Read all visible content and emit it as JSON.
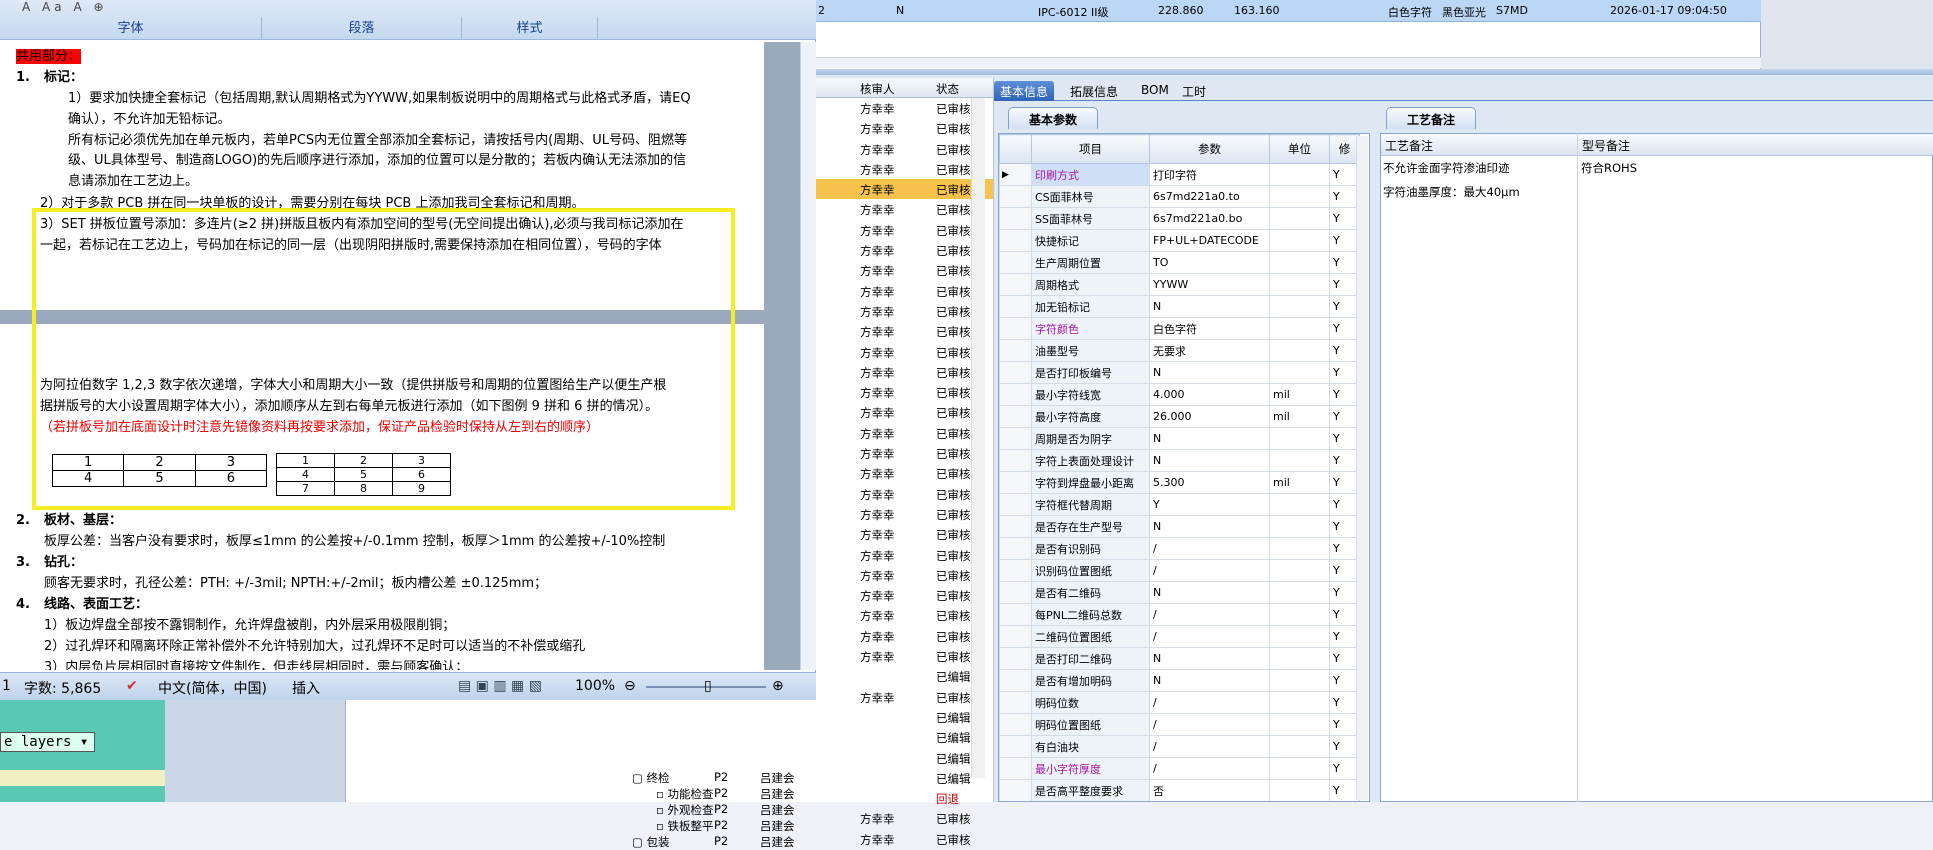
{
  "top_row": {
    "col1": "2",
    "col2": "N",
    "col3": "IPC-6012 II级",
    "col4": "228.860",
    "col5": "163.160",
    "col6": "白色字符",
    "col7": "黑色亚光",
    "col8": "S7MD",
    "col9": "2026-01-17 09:04:50"
  },
  "ribbon": {
    "font": "字体",
    "paragraph": "段落",
    "style": "样式"
  },
  "doc": {
    "heading": "共用部分：",
    "s1": "1.",
    "s1_title": "标记：",
    "l1": "1）要求加快捷全套标记（包括周期,默认周期格式为YYWW,如果制板说明中的周期格式与此格式矛盾，请EQ",
    "l2": "确认），不允许加无铅标记。",
    "l3": "所有标记必须优先加在单元板内，若单PCS内无位置全部添加全套标记，请按括号内(周期、UL号码、阻燃等",
    "l4": "级、UL具体型号、制造商LOGO)的先后顺序进行添加，添加的位置可以是分散的；若板内确认无法添加的信",
    "l5": "息请添加在工艺边上。",
    "l6": "2）对于多款 PCB 拼在同一块单板的设计，需要分别在每块 PCB 上添加我司全套标记和周期。",
    "l7": "3）SET 拼板位置号添加：多连片(≥2 拼)拼版且板内有添加空间的型号(无空间提出确认),必须与我司标记添加在",
    "l8": "一起，若标记在工艺边上，号码加在标记的同一层（出现阴阳拼版时,需要保持添加在相同位置），号码的字体",
    "l9": "为阿拉伯数字 1,2,3 数字依次递增，字体大小和周期大小一致（提供拼版号和周期的位置图给生产以便生产根",
    "l10": "据拼版号的大小设置周期字体大小），添加顺序从左到右每单元板进行添加（如下图例 9 拼和 6 拼的情况）。",
    "l11": "（若拼板号加在底面设计时注意先镜像资料再按要求添加，保证产品检验时保持从左到右的顺序）",
    "t6": [
      "1",
      "2",
      "3",
      "4",
      "5",
      "6"
    ],
    "t9": [
      "1",
      "2",
      "3",
      "4",
      "5",
      "6",
      "7",
      "8",
      "9"
    ],
    "s2": "2.",
    "s2_title": "板材、基层：",
    "l12": "板厚公差：当客户没有要求时，板厚≤1mm 的公差按+/-0.1mm 控制，板厚＞1mm 的公差按+/-10%控制",
    "s3": "3.",
    "s3_title": "钻孔：",
    "l13": "顾客无要求时，孔径公差：PTH: +/-3mil; NPTH:+/-2mil；板内槽公差 ±0.125mm；",
    "s4": "4.",
    "s4_title": "线路、表面工艺：",
    "l14": "1）板边焊盘全部按不露铜制作，允许焊盘被削，内外层采用极限削铜；",
    "l15": "2）过孔焊环和隔离环除正常补偿外不允许特别加大，过孔焊环不足时可以适当的不补偿或缩孔",
    "l16": "3）内层负片层相同时直接按文件制作，但走线层相同时，需与顾客确认；"
  },
  "status": {
    "words": "字数: 5,865",
    "lang": "中文(简体，中国)",
    "mode": "插入",
    "zoom": "100%",
    "page": "1"
  },
  "tree": {
    "headers": [
      "核审人",
      "状态"
    ],
    "reviewer": "方幸幸",
    "status_ok": "已审核",
    "status_edit": "已编辑",
    "status_back": "回退",
    "rows": [
      {
        "r": "方幸幸",
        "s": "已审核"
      },
      {
        "r": "方幸幸",
        "s": "已审核"
      },
      {
        "r": "方幸幸",
        "s": "已审核"
      },
      {
        "r": "方幸幸",
        "s": "已审核"
      },
      {
        "r": "方幸幸",
        "s": "已审核",
        "sel": true
      },
      {
        "r": "方幸幸",
        "s": "已审核"
      },
      {
        "r": "方幸幸",
        "s": "已审核"
      },
      {
        "r": "方幸幸",
        "s": "已审核"
      },
      {
        "r": "方幸幸",
        "s": "已审核"
      },
      {
        "r": "方幸幸",
        "s": "已审核"
      },
      {
        "r": "方幸幸",
        "s": "已审核"
      },
      {
        "r": "方幸幸",
        "s": "已审核"
      },
      {
        "r": "方幸幸",
        "s": "已审核"
      },
      {
        "r": "方幸幸",
        "s": "已审核"
      },
      {
        "r": "方幸幸",
        "s": "已审核"
      },
      {
        "r": "方幸幸",
        "s": "已审核"
      },
      {
        "r": "方幸幸",
        "s": "已审核"
      },
      {
        "r": "方幸幸",
        "s": "已审核"
      },
      {
        "r": "方幸幸",
        "s": "已审核"
      },
      {
        "r": "方幸幸",
        "s": "已审核"
      },
      {
        "r": "方幸幸",
        "s": "已审核"
      },
      {
        "r": "方幸幸",
        "s": "已审核"
      },
      {
        "r": "方幸幸",
        "s": "已审核"
      },
      {
        "r": "方幸幸",
        "s": "已审核"
      },
      {
        "r": "方幸幸",
        "s": "已审核"
      },
      {
        "r": "方幸幸",
        "s": "已审核"
      },
      {
        "r": "方幸幸",
        "s": "已审核"
      },
      {
        "r": "方幸幸",
        "s": "已审核"
      },
      {
        "r": "",
        "s": "已编辑"
      },
      {
        "r": "方幸幸",
        "s": "已审核"
      },
      {
        "r": "",
        "s": "已编辑"
      },
      {
        "r": "",
        "s": "已编辑"
      },
      {
        "r": "",
        "s": "已编辑"
      },
      {
        "r": "",
        "s": "已编辑"
      },
      {
        "r": "",
        "s": "回退"
      },
      {
        "r": "方幸幸",
        "s": "已审核"
      },
      {
        "r": "方幸幸",
        "s": "已审核"
      }
    ]
  },
  "tabs": [
    "基本信息",
    "拓展信息",
    "BOM",
    "工时"
  ],
  "subtab_left": "基本参数",
  "subtab_right": "工艺备注",
  "grid": {
    "headers": [
      "项目",
      "参数",
      "单位",
      "修"
    ],
    "rows": [
      {
        "n": "印刷方式",
        "v": "打印字符",
        "u": "",
        "y": "Y",
        "p": true,
        "cur": true
      },
      {
        "n": "CS面菲林号",
        "v": "6s7md221a0.to",
        "u": "",
        "y": "Y"
      },
      {
        "n": "SS面菲林号",
        "v": "6s7md221a0.bo",
        "u": "",
        "y": "Y"
      },
      {
        "n": "快捷标记",
        "v": "FP+UL+DATECODE",
        "u": "",
        "y": "Y"
      },
      {
        "n": "生产周期位置",
        "v": "TO",
        "u": "",
        "y": "Y"
      },
      {
        "n": "周期格式",
        "v": "YYWW",
        "u": "",
        "y": "Y"
      },
      {
        "n": "加无铅标记",
        "v": "N",
        "u": "",
        "y": "Y"
      },
      {
        "n": "字符颜色",
        "v": "白色字符",
        "u": "",
        "y": "Y",
        "p": true
      },
      {
        "n": "油墨型号",
        "v": "无要求",
        "u": "",
        "y": "Y"
      },
      {
        "n": "是否打印板编号",
        "v": "N",
        "u": "",
        "y": "Y"
      },
      {
        "n": "最小字符线宽",
        "v": "4.000",
        "u": "mil",
        "y": "Y"
      },
      {
        "n": "最小字符高度",
        "v": "26.000",
        "u": "mil",
        "y": "Y"
      },
      {
        "n": "周期是否为阴字",
        "v": "N",
        "u": "",
        "y": "Y"
      },
      {
        "n": "字符上表面处理设计",
        "v": "N",
        "u": "",
        "y": "Y"
      },
      {
        "n": "字符到焊盘最小距离",
        "v": "5.300",
        "u": "mil",
        "y": "Y"
      },
      {
        "n": "字符框代替周期",
        "v": "Y",
        "u": "",
        "y": "Y"
      },
      {
        "n": "是否存在生产型号",
        "v": "N",
        "u": "",
        "y": "Y"
      },
      {
        "n": "是否有识别码",
        "v": "/",
        "u": "",
        "y": "Y"
      },
      {
        "n": "识别码位置图纸",
        "v": "/",
        "u": "",
        "y": "Y"
      },
      {
        "n": "是否有二维码",
        "v": "N",
        "u": "",
        "y": "Y"
      },
      {
        "n": "每PNL二维码总数",
        "v": "/",
        "u": "",
        "y": "Y"
      },
      {
        "n": "二维码位置图纸",
        "v": "/",
        "u": "",
        "y": "Y"
      },
      {
        "n": "是否打印二维码",
        "v": "N",
        "u": "",
        "y": "Y"
      },
      {
        "n": "是否有增加明码",
        "v": "N",
        "u": "",
        "y": "Y"
      },
      {
        "n": "明码位数",
        "v": "/",
        "u": "",
        "y": "Y"
      },
      {
        "n": "明码位置图纸",
        "v": "/",
        "u": "",
        "y": "Y"
      },
      {
        "n": "有白油块",
        "v": "/",
        "u": "",
        "y": "Y"
      },
      {
        "n": "最小字符厚度",
        "v": "/",
        "u": "",
        "y": "Y",
        "p": true
      },
      {
        "n": "是否高平整度要求",
        "v": "否",
        "u": "",
        "y": "Y"
      }
    ]
  },
  "notes": {
    "h1": "工艺备注",
    "h2": "型号备注",
    "n1": "不允许金面字符渗油印迹",
    "n2": "字符油墨厚度：最大40μm",
    "n3": "符合ROHS"
  },
  "bottom": {
    "layers": "e layers",
    "tree_rows": [
      {
        "t": "终检",
        "c": "P2",
        "r": "吕建会",
        "s": "方幸幸",
        "st": "已审核"
      },
      {
        "t": "功能检查",
        "c": "P2",
        "r": "吕建会",
        "s": "方幸幸",
        "st": "已审核"
      },
      {
        "t": "外观检查",
        "c": "P2",
        "r": "吕建会",
        "s": "方幸幸",
        "st": "已审核"
      },
      {
        "t": "铁板整平",
        "c": "P2",
        "r": "吕建会",
        "s": "方幸幸",
        "st": "已审核"
      },
      {
        "t": "包装",
        "c": "P2",
        "r": "吕建会",
        "s": "方幸幸",
        "st": "已审核"
      }
    ]
  }
}
